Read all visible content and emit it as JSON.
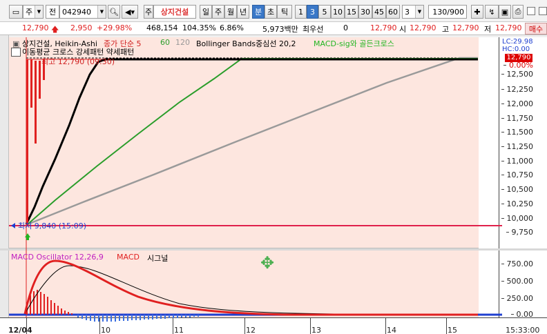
{
  "toolbar": {
    "market_selector": "주",
    "market_mode": "전",
    "stock_code": "042940",
    "stock_name_prefix": "주",
    "stock_name": "상지건설",
    "period_buttons": [
      "일",
      "주",
      "월",
      "년",
      "분",
      "초",
      "틱"
    ],
    "selected_period": "분",
    "interval_buttons": [
      "1",
      "3",
      "5",
      "10",
      "15",
      "30",
      "45",
      "60"
    ],
    "selected_interval": "3",
    "interval_value": "3",
    "bar_count": "130/900"
  },
  "quote": {
    "price": "12,790",
    "change": "2,950",
    "change_pct": "+29.98%",
    "volume": "468,154",
    "volume_ratio": "104.35%",
    "turnover_rate": "6.86%",
    "trade_amount": "5,973백만",
    "pref_label": "최우선",
    "pref_value": "0",
    "ask_price": "12,790",
    "open_label": "시",
    "open": "12,790",
    "high_label": "고",
    "high": "12,790",
    "low_label": "저",
    "low": "12,790",
    "buy_button": "매수"
  },
  "legend_top": {
    "stock": "상지건설, Heikin-Ashi",
    "ma": "종가 단순 5",
    "ma60": "60",
    "ma120": "120",
    "bollinger": "Bollinger Bands중심선 20,2",
    "macd_sig": "MACD-sig와 골든크로스",
    "pattern_line": "이동평균 크로스 강세패턴   약세패턴",
    "high_label": "최고 12,790 (09:30)",
    "low_label": "최저 9,840 (15:09)",
    "lc": "LC:29.98",
    "hc": "HC:0.00",
    "last_price": "12,790",
    "hc_pct": "0.00%"
  },
  "legend_bottom": {
    "oscillator": "MACD Oscillator 12,26,9",
    "macd": "MACD",
    "signal": "시그널"
  },
  "price_axis": [
    "12,500",
    "12,250",
    "12,000",
    "11,750",
    "11,500",
    "11,250",
    "11,000",
    "10,750",
    "10,500",
    "10,250",
    "10,000",
    "9,750"
  ],
  "macd_axis": [
    "750.00",
    "500.00",
    "250.00",
    "0.00"
  ],
  "time_axis": [
    "12/04",
    "10",
    "11",
    "12",
    "13",
    "14",
    "15"
  ],
  "current_time": "15:33:00",
  "colors": {
    "plot_bg": "#fde6df",
    "up": "#e02020",
    "ma5": "#000000",
    "ma60": "#2a9d2a",
    "ma120": "#9a9a9a",
    "limit_line": "#e0204a",
    "signal_line": "#000000",
    "oscillator_down": "#3a6ee0"
  }
}
